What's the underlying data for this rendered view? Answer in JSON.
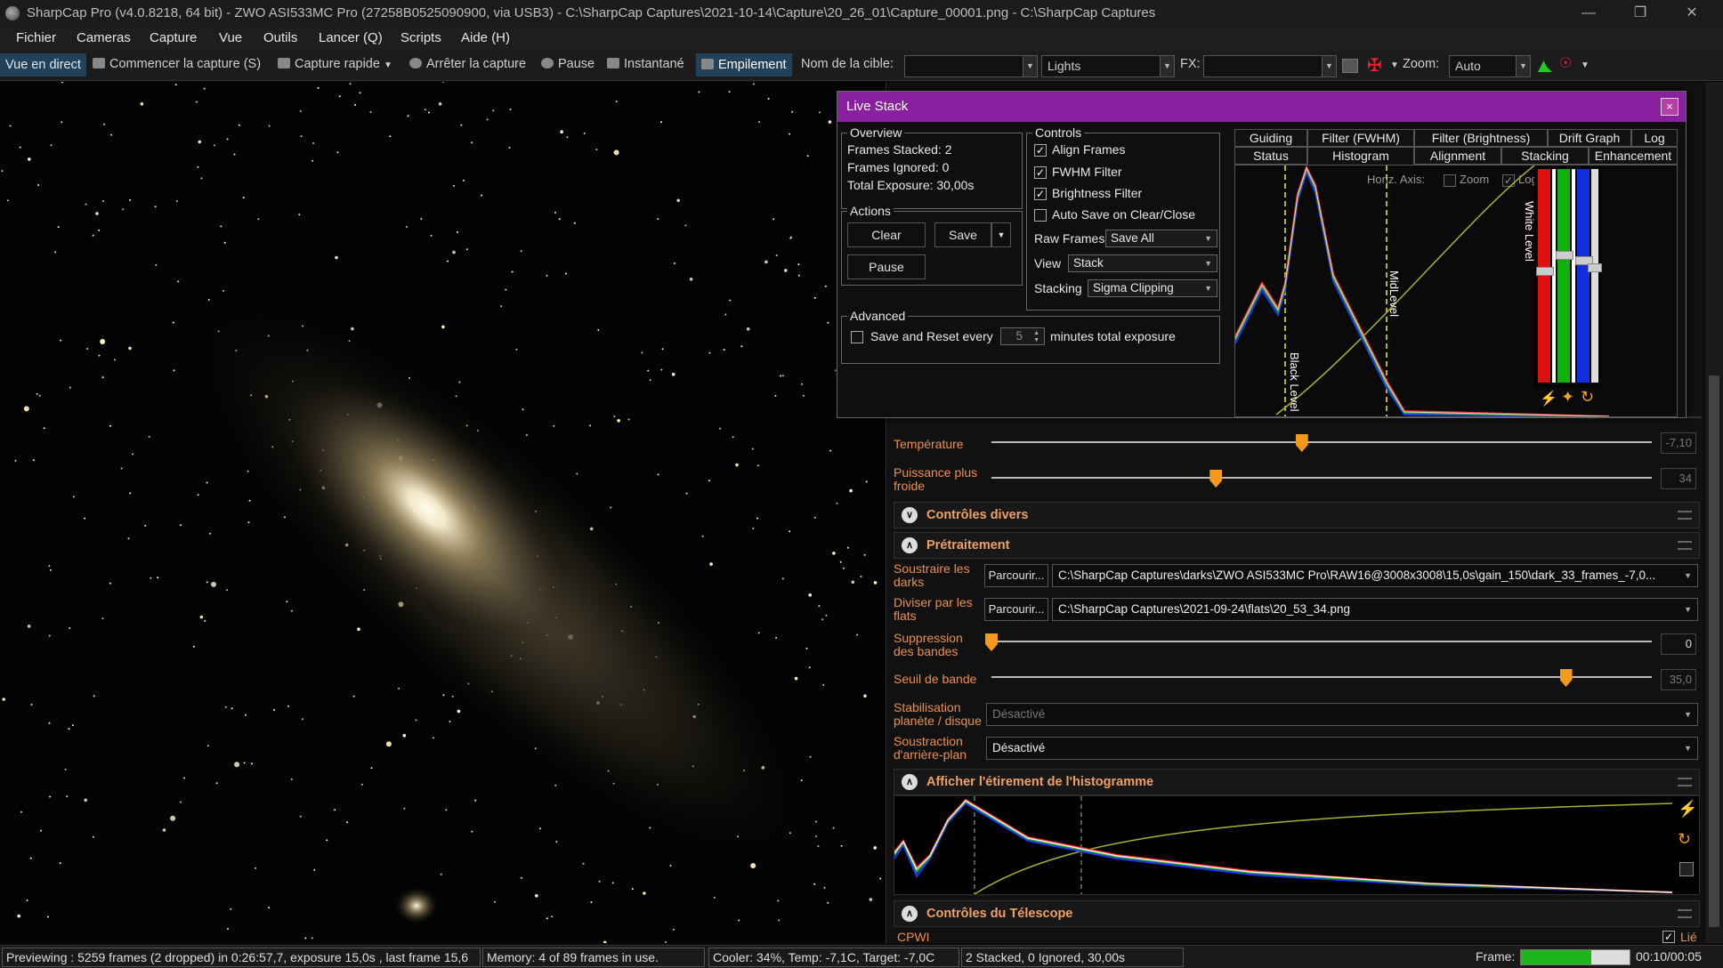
{
  "title": "SharpCap Pro (v4.0.8218, 64 bit) - ZWO ASI533MC Pro (27258B0525090900, via USB3) - C:\\SharpCap Captures\\2021-10-14\\Capture\\20_26_01\\Capture_00001.png - C:\\SharpCap Captures",
  "window_buttons": {
    "minimize": "—",
    "restore": "❐",
    "close": "✕"
  },
  "menu": [
    "Fichier",
    "Cameras",
    "Capture",
    "Vue",
    "Outils",
    "Lancer (Q)",
    "Scripts",
    "Aide (H)"
  ],
  "toolbar": {
    "live_view": "Vue en direct",
    "start_capture": "Commencer la capture (S)",
    "quick_capture": "Capture rapide",
    "stop_capture": "Arrêter la capture",
    "pause": "Pause",
    "snapshot": "Instantané",
    "stacking": "Empilement",
    "target_label": "Nom de la cible:",
    "target_value": "",
    "frame_type": "Lights",
    "fx_label": "FX:",
    "fx_value": "",
    "zoom_label": "Zoom:",
    "zoom_value": "Auto"
  },
  "live_stack": {
    "title": "Live Stack",
    "close": "×",
    "overview": {
      "title": "Overview",
      "frames_stacked": "Frames Stacked: 2",
      "frames_ignored": "Frames Ignored: 0",
      "total_exposure": "Total Exposure: 30,00s"
    },
    "actions": {
      "title": "Actions",
      "clear": "Clear",
      "save": "Save",
      "pause": "Pause"
    },
    "advanced": {
      "title": "Advanced",
      "save_reset_label": "Save and Reset every",
      "minutes_value": "5",
      "minutes_label": "minutes total exposure"
    },
    "controls": {
      "title": "Controls",
      "align_frames": "Align Frames",
      "fwhm_filter": "FWHM Filter",
      "brightness_filter": "Brightness Filter",
      "auto_save": "Auto Save on Clear/Close",
      "raw_frames_label": "Raw Frames",
      "raw_frames_value": "Save All",
      "view_label": "View",
      "view_value": "Stack",
      "stacking_label": "Stacking",
      "stacking_value": "Sigma Clipping"
    },
    "tabs_row1": [
      "Guiding",
      "Filter (FWHM)",
      "Filter (Brightness)",
      "Drift Graph",
      "Log"
    ],
    "tabs_row2": [
      "Status",
      "Histogram",
      "Alignment",
      "Stacking",
      "Enhancement"
    ],
    "active_tab": "Histogram",
    "histogram": {
      "horiz_axis": "Horiz. Axis:",
      "zoom": "Zoom",
      "log": "Log",
      "black_level": "Black Level",
      "mid_level": "MidLevel",
      "white_level": "White Level"
    }
  },
  "right_panel": {
    "temperature_label": "Température",
    "temperature_value": "-7,10",
    "temperature_level": 0.47,
    "cooler_label": "Puissance plus froide",
    "cooler_value": "34",
    "cooler_level": 0.34,
    "misc_section": "Contrôles divers",
    "preprocessing_section": "Prétraitement",
    "subtract_darks_label": "Soustraire les darks",
    "browse": "Parcourir...",
    "darks_path": "C:\\SharpCap Captures\\darks\\ZWO ASI533MC Pro\\RAW16@3008x3008\\15,0s\\gain_150\\dark_33_frames_-7,0...",
    "divide_flats_label": "Diviser par les flats",
    "flats_path": "C:\\SharpCap Captures\\2021-09-24\\flats\\20_53_34.png",
    "banding_label": "Suppression des bandes",
    "banding_value": "0",
    "banding_level": 0.0,
    "band_threshold_label": "Seuil de bande",
    "band_threshold_value": "35,0",
    "band_threshold_level": 0.87,
    "stabilisation_label": "Stabilisation planète / disque",
    "stabilisation_value": "Désactivé",
    "background_label": "Soustraction d'arrière-plan",
    "background_value": "Désactivé",
    "histogram_section": "Afficher l'étirement de l'histogramme",
    "telescope_section": "Contrôles du Télescope",
    "telescope_name": "CPWI",
    "linked_label": "Lié"
  },
  "status": {
    "preview": "Previewing : 5259 frames (2 dropped) in 0:26:57,7, exposure 15,0s , last frame 15,6",
    "memory": "Memory: 4 of 89 frames in use.",
    "cooler": "Cooler: 34%, Temp: -7,1C, Target: -7,0C",
    "stacked": "2 Stacked, 0 Ignored, 30,00s",
    "frame_label": "Frame:",
    "frame_time": "00:10/00:05",
    "frame_progress": 0.65
  },
  "colors": {
    "accent": "#8a1fa0",
    "orange": "#f39a1c",
    "label": "#ec8f4a",
    "progress": "#1fb51f"
  }
}
